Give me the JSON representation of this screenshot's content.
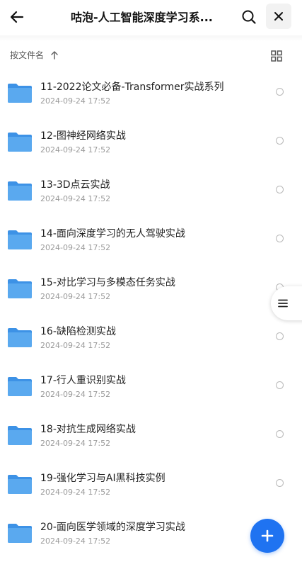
{
  "header": {
    "title": "咕泡-人工智能深度学习系..."
  },
  "sortbar": {
    "label": "按文件名"
  },
  "files": [
    {
      "name": "11-2022论文必备-Transformer实战系列",
      "date": "2024-09-24 17:52"
    },
    {
      "name": "12-图神经网络实战",
      "date": "2024-09-24 17:52"
    },
    {
      "name": "13-3D点云实战",
      "date": "2024-09-24 17:52"
    },
    {
      "name": "14-面向深度学习的无人驾驶实战",
      "date": "2024-09-24 17:52"
    },
    {
      "name": "15-对比学习与多模态任务实战",
      "date": "2024-09-24 17:52"
    },
    {
      "name": "16-缺陷检测实战",
      "date": "2024-09-24 17:52"
    },
    {
      "name": "17-行人重识别实战",
      "date": "2024-09-24 17:52"
    },
    {
      "name": "18-对抗生成网络实战",
      "date": "2024-09-24 17:52"
    },
    {
      "name": "19-强化学习与AI黑科技实例",
      "date": "2024-09-24 17:52"
    },
    {
      "name": "20-面向医学领域的深度学习实战",
      "date": "2024-09-24 17:52"
    }
  ],
  "colors": {
    "accent": "#1f73f1",
    "folder": "#5aa9ef",
    "folder_dark": "#3d92e6"
  },
  "icons": {
    "back": "arrow-left-icon",
    "search": "search-icon",
    "close": "close-icon",
    "sort": "arrow-up-icon",
    "grid": "grid-view-icon",
    "folder": "folder-icon",
    "menu": "menu-icon",
    "add": "plus-icon"
  }
}
